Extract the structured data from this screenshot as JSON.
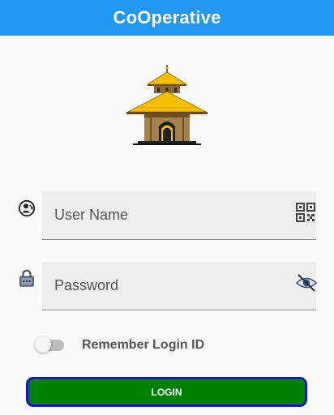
{
  "app_bar": {
    "title": "CoOperative",
    "color": "#2196f3"
  },
  "logo": {
    "icon": "temple-logo-icon"
  },
  "form": {
    "username": {
      "placeholder": "User Name",
      "value": "",
      "prefix_icon": "account-circle-icon",
      "suffix_icon": "qr-code-icon"
    },
    "password": {
      "placeholder": "Password",
      "value": "",
      "prefix_icon": "lock-icon",
      "suffix_icon": "eye-off-icon"
    },
    "remember": {
      "label": "Remember Login ID",
      "enabled": false
    }
  },
  "login_button": {
    "label": "LOGIN",
    "background": "#008000",
    "border": "#1515c8"
  }
}
